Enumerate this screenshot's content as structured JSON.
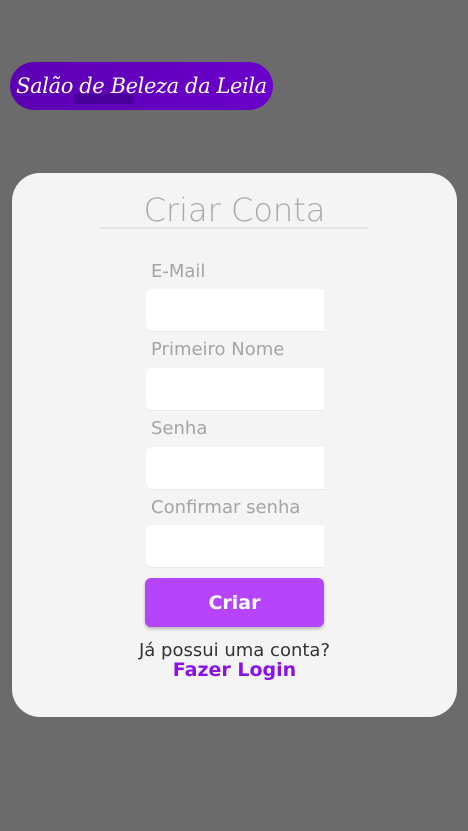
{
  "brand": {
    "name": "Salão de Beleza da Leila"
  },
  "form": {
    "title": "Criar Conta",
    "fields": [
      {
        "label": "E-Mail",
        "value": "",
        "placeholder": ""
      },
      {
        "label": "Primeiro Nome",
        "value": "",
        "placeholder": ""
      },
      {
        "label": "Senha",
        "value": "",
        "placeholder": ""
      },
      {
        "label": "Confirmar senha",
        "value": "",
        "placeholder": ""
      }
    ],
    "submit_label": "Criar",
    "login_prompt": "Já possui uma conta?",
    "login_link": "Fazer Login"
  },
  "colors": {
    "background": "#6b6b6b",
    "brand_pill": "#5c00b3",
    "card": "#f4f4f4",
    "button": "#b544fb",
    "link": "#8a11e8"
  }
}
